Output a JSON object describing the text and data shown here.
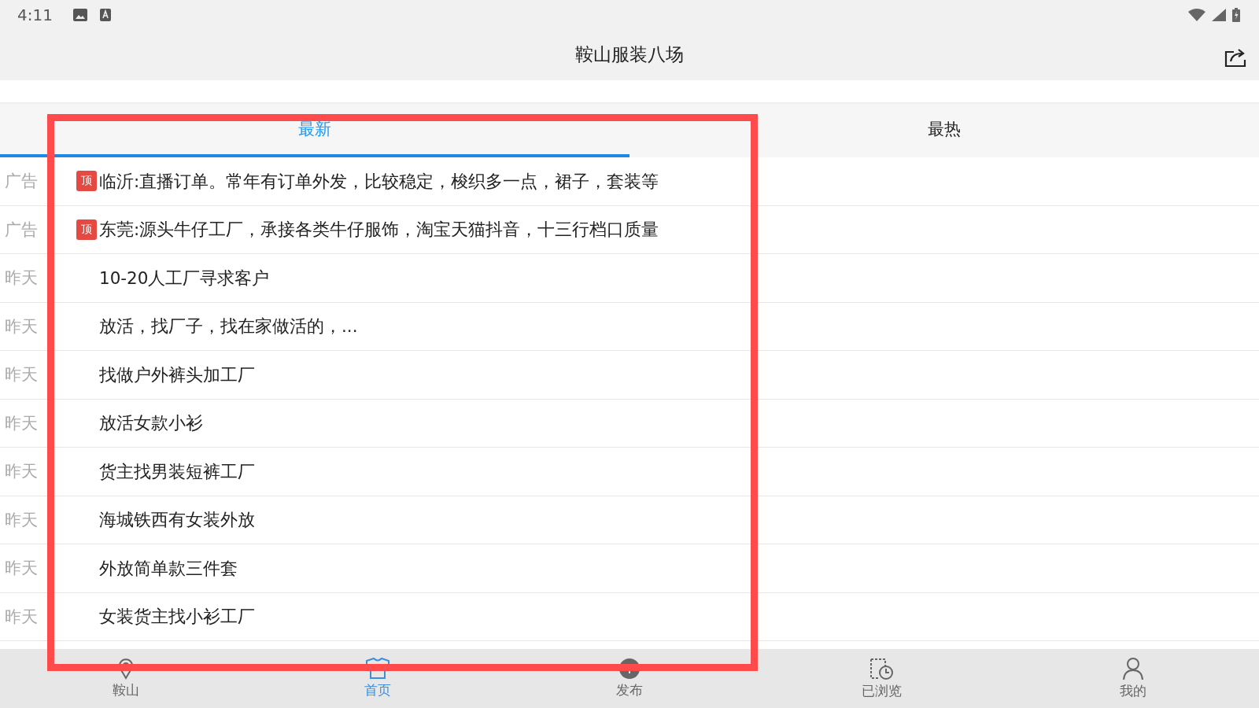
{
  "status_bar": {
    "time": "4:11"
  },
  "header": {
    "title": "鞍山服装八场"
  },
  "tabs": [
    {
      "label": "最新",
      "selected": true
    },
    {
      "label": "最热",
      "selected": false
    }
  ],
  "rows": [
    {
      "date": "广告",
      "badge": "顶",
      "title": "临沂:直播订单。常年有订单外发，比较稳定，梭织多一点，裙子，套装等"
    },
    {
      "date": "广告",
      "badge": "顶",
      "title": "东莞:源头牛仔工厂，承接各类牛仔服饰，淘宝天猫抖音，十三行档口质量"
    },
    {
      "date": "昨天",
      "title": "10-20人工厂寻求客户"
    },
    {
      "date": "昨天",
      "title": "放活，找厂子，找在家做活的，..."
    },
    {
      "date": "昨天",
      "title": "找做户外裤头加工厂"
    },
    {
      "date": "昨天",
      "title": "放活女款小衫"
    },
    {
      "date": "昨天",
      "title": "货主找男装短裤工厂"
    },
    {
      "date": "昨天",
      "title": "海城铁西有女装外放"
    },
    {
      "date": "昨天",
      "title": "外放简单款三件套"
    },
    {
      "date": "昨天",
      "title": "女装货主找小衫工厂"
    }
  ],
  "bottom_nav": [
    {
      "label": "鞍山",
      "kind": "location",
      "selected": false
    },
    {
      "label": "首页",
      "kind": "home",
      "selected": true
    },
    {
      "label": "发布",
      "kind": "publish",
      "selected": false
    },
    {
      "label": "已浏览",
      "kind": "history",
      "selected": false
    },
    {
      "label": "我的",
      "kind": "profile",
      "selected": false
    }
  ]
}
